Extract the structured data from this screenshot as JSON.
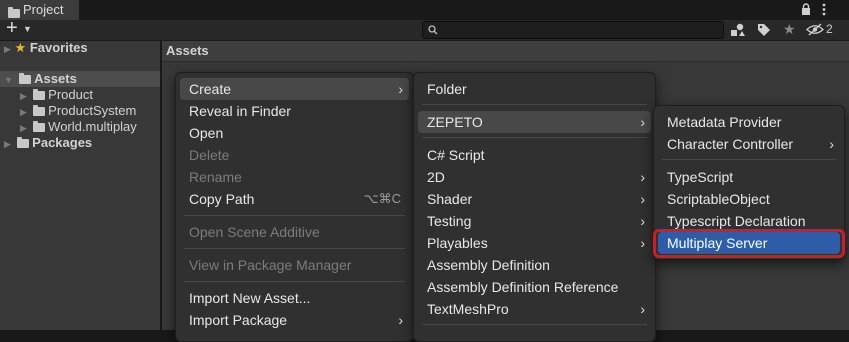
{
  "window": {
    "tab_title": "Project",
    "hidden_count": "2"
  },
  "toolbar": {
    "add_label": "+",
    "search_placeholder": ""
  },
  "breadcrumb": {
    "path": "Assets"
  },
  "tree": {
    "favorites": "Favorites",
    "assets": "Assets",
    "children": [
      "Product",
      "ProductSystem",
      "World.multiplay"
    ],
    "packages": "Packages"
  },
  "menu1": {
    "create": "Create",
    "reveal": "Reveal in Finder",
    "open": "Open",
    "delete": "Delete",
    "rename": "Rename",
    "copy_path": "Copy Path",
    "copy_path_shortcut": "⌥⌘C",
    "open_scene_additive": "Open Scene Additive",
    "view_in_package_manager": "View in Package Manager",
    "import_new_asset": "Import New Asset...",
    "import_package": "Import Package"
  },
  "menu2": {
    "folder": "Folder",
    "zepeto": "ZEPETO",
    "csharp": "C# Script",
    "two_d": "2D",
    "shader": "Shader",
    "testing": "Testing",
    "playables": "Playables",
    "assembly_def": "Assembly Definition",
    "assembly_def_ref": "Assembly Definition Reference",
    "textmeshpro": "TextMeshPro"
  },
  "menu3": {
    "metadata_provider": "Metadata Provider",
    "character_controller": "Character Controller",
    "typescript": "TypeScript",
    "scriptable_object": "ScriptableObject",
    "typescript_declaration": "Typescript Declaration",
    "multiplay_server": "Multiplay Server"
  },
  "colors": {
    "highlight_blue": "#2d5da9",
    "annotation_red": "#d41a22"
  }
}
